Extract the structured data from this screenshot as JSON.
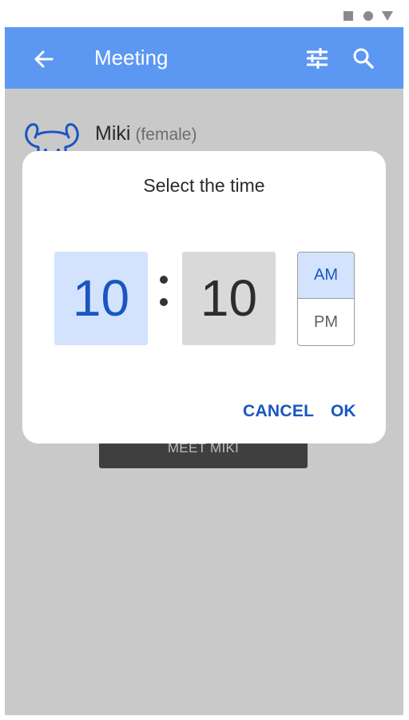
{
  "status_bar": {
    "icons": [
      "square-icon",
      "circle-icon",
      "triangle-icon"
    ]
  },
  "app_bar": {
    "title": "Meeting",
    "color": "#5c97f2",
    "icons": [
      "arrow-left-icon",
      "sliders-icon",
      "search-icon"
    ]
  },
  "profile": {
    "name": "Miki",
    "gender": "(female)",
    "avatar_icon": "dog-face-icon"
  },
  "meet_button": {
    "label": "MEET MIKI"
  },
  "dialog": {
    "title": "Select the time",
    "hour": "10",
    "minute": "10",
    "separator": ":",
    "am_label": "AM",
    "pm_label": "PM",
    "selected_period": "AM",
    "cancel_label": "CANCEL",
    "ok_label": "OK",
    "accent_color": "#1a56c2",
    "highlight_color": "#d3e3fd"
  }
}
